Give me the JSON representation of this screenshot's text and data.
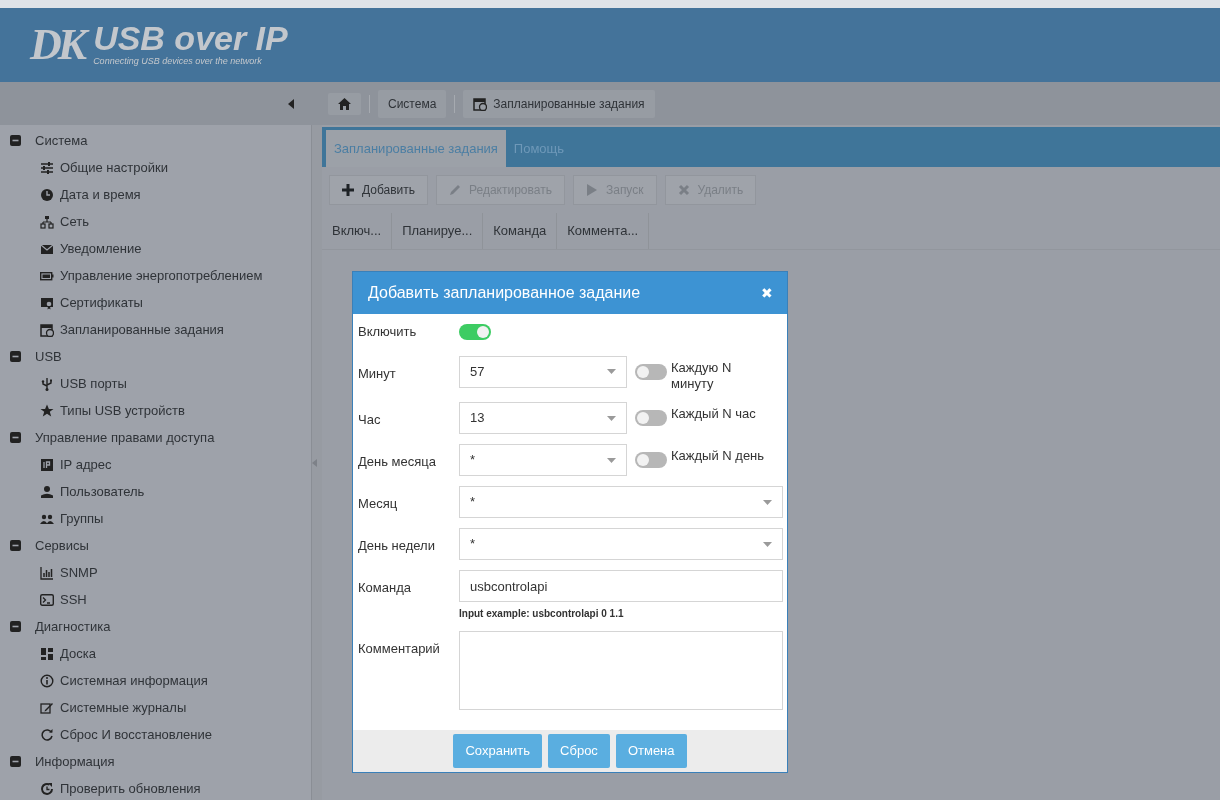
{
  "header": {
    "logo_mark": "DK",
    "title": "USB over IP",
    "subtitle": "Connecting USB devices over the network"
  },
  "breadcrumb": [
    "Система",
    "Запланированные задания"
  ],
  "sidebar": {
    "groups": [
      {
        "label": "Система",
        "expanded": true,
        "items": [
          "Общие настройки",
          "Дата и время",
          "Сеть",
          "Уведомление",
          "Управление энергопотреблением",
          "Сертификаты",
          "Запланированные задания"
        ]
      },
      {
        "label": "USB",
        "expanded": true,
        "items": [
          "USB порты",
          "Типы USB устройств"
        ]
      },
      {
        "label": "Управление правами доступа",
        "expanded": true,
        "items": [
          "IP адрес",
          "Пользователь",
          "Группы"
        ]
      },
      {
        "label": "Сервисы",
        "expanded": true,
        "items": [
          "SNMP",
          "SSH"
        ]
      },
      {
        "label": "Диагностика",
        "expanded": true,
        "items": [
          "Доска",
          "Системная информация",
          "Системные журналы",
          "Сброс И восстановление"
        ]
      },
      {
        "label": "Информация",
        "expanded": true,
        "items": [
          "Проверить обновления"
        ]
      }
    ]
  },
  "tabs": [
    {
      "label": "Запланированные задания",
      "selected": true
    },
    {
      "label": "Помощь",
      "selected": false
    }
  ],
  "toolbar": [
    {
      "label": "Добавить",
      "disabled": false
    },
    {
      "label": "Редактировать",
      "disabled": true
    },
    {
      "label": "Запуск",
      "disabled": true
    },
    {
      "label": "Удалить",
      "disabled": true
    }
  ],
  "table": {
    "columns": [
      "Включ...",
      "Планируе...",
      "Команда",
      "Коммента..."
    ]
  },
  "dialog": {
    "title": "Добавить запланированное задание",
    "close": "✖",
    "fields": [
      {
        "kind": "toggle",
        "label": "Включить",
        "on": true
      },
      {
        "kind": "select",
        "label": "Минут",
        "value": "57",
        "repeat": {
          "label": "Каждую N минуту",
          "on": false
        }
      },
      {
        "kind": "select",
        "label": "Час",
        "value": "13",
        "repeat": {
          "label": "Каждый N час",
          "on": false
        }
      },
      {
        "kind": "select",
        "label": "День месяца",
        "value": "*",
        "repeat": {
          "label": "Каждый N день",
          "on": false
        }
      },
      {
        "kind": "select",
        "label": "Месяц",
        "value": "*"
      },
      {
        "kind": "select",
        "label": "День недели",
        "value": "*"
      },
      {
        "kind": "text",
        "label": "Команда",
        "value": "usbcontrolapi",
        "help": "Input example: usbcontrolapi 0 1.1"
      },
      {
        "kind": "textarea",
        "label": "Комментарий"
      }
    ],
    "buttons": [
      "Сохранить",
      "Сброс",
      "Отмена"
    ]
  }
}
